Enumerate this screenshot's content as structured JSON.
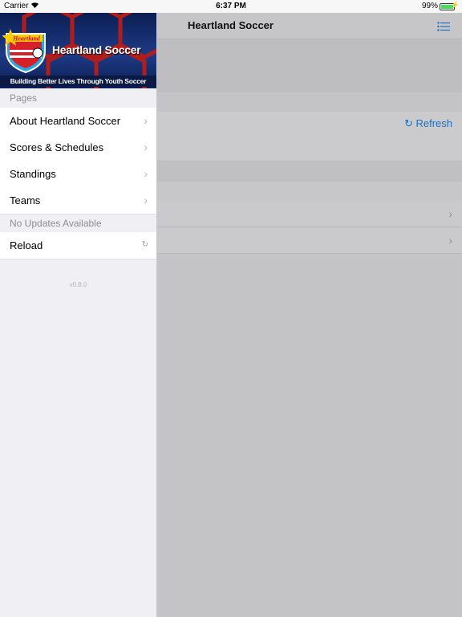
{
  "status_bar": {
    "carrier": "Carrier",
    "time": "6:37 PM",
    "battery_pct": "99%",
    "battery_level": 0.99
  },
  "header": {
    "title": "Heartland Soccer"
  },
  "content": {
    "refresh_label": "Refresh"
  },
  "sidebar": {
    "banner_title": "Heartland Soccer",
    "banner_tagline": "Building Better Lives Through Youth Soccer",
    "logo_text": "Heartland",
    "pages_header": "Pages",
    "items": [
      {
        "label": "About Heartland Soccer"
      },
      {
        "label": "Scores & Schedules"
      },
      {
        "label": "Standings"
      },
      {
        "label": "Teams"
      }
    ],
    "updates_header": "No Updates Available",
    "reload_label": "Reload",
    "version": "v0.8.0"
  },
  "colors": {
    "accent": "#1f6fbf",
    "banner": "#1f3b86"
  }
}
